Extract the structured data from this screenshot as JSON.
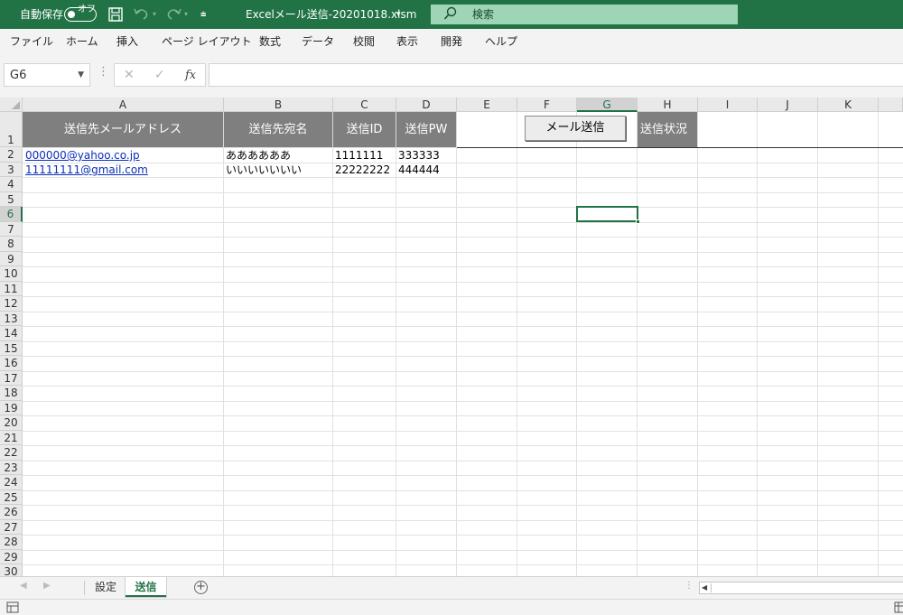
{
  "titlebar": {
    "autosave_label": "自動保存",
    "autosave_state": "オフ",
    "file_title": "Excelメール送信-20201018.xlsm",
    "title_dropdown": "▾",
    "customize_icon": "⩧",
    "search_placeholder": "検索"
  },
  "menu": {
    "items": [
      "ファイル",
      "ホーム",
      "挿入",
      "ページ レイアウト",
      "数式",
      "データ",
      "校閲",
      "表示",
      "開発",
      "ヘルプ"
    ]
  },
  "formula_bar": {
    "name_box": "G6",
    "formula": ""
  },
  "sheet": {
    "columns": [
      "A",
      "B",
      "C",
      "D",
      "E",
      "F",
      "G",
      "H",
      "I",
      "J",
      "K"
    ],
    "selected_column": "G",
    "rows": [
      "1",
      "2",
      "3",
      "4",
      "5",
      "6",
      "7",
      "8",
      "9",
      "10",
      "11",
      "12",
      "13",
      "14",
      "15",
      "16",
      "17",
      "18",
      "19",
      "20",
      "21",
      "22",
      "23",
      "24",
      "25",
      "26",
      "27",
      "28",
      "29",
      "30"
    ],
    "selected_row": "6",
    "headers": {
      "A": "送信先メールアドレス",
      "B": "送信先宛名",
      "C": "送信ID",
      "D": "送信PW",
      "H": "送信状況"
    },
    "data_rows": [
      {
        "A": "000000@yahoo.co.jp",
        "B": "ああああああ",
        "C": "1111111",
        "D": "333333"
      },
      {
        "A": "11111111@gmail.com",
        "B": "いいいいいいい",
        "C": "22222222",
        "D": "444444"
      }
    ],
    "mail_button_label": "メール送信",
    "active_cell": "G6"
  },
  "tabs": {
    "items": [
      {
        "label": "設定",
        "active": false
      },
      {
        "label": "送信",
        "active": true
      }
    ],
    "add_label": "+"
  },
  "colors": {
    "excel_green": "#217346",
    "header_fill": "#7f7f7f",
    "link_color": "#0b2fb8"
  }
}
